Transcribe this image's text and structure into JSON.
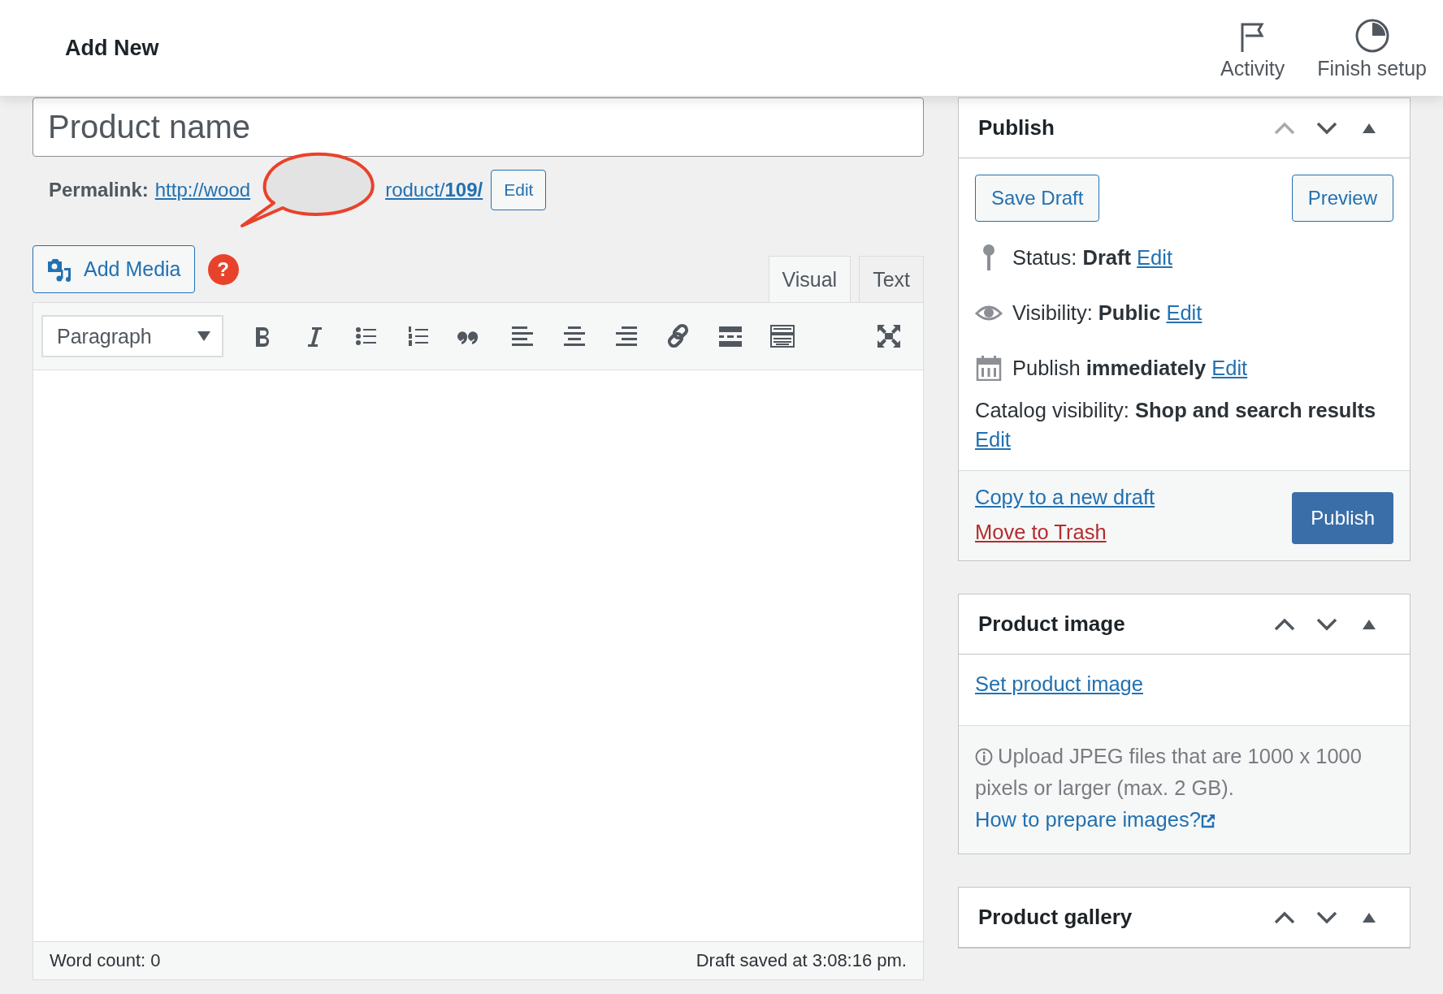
{
  "header": {
    "title": "Add New",
    "actions": [
      {
        "kind": "activity",
        "label": "Activity"
      },
      {
        "kind": "setup",
        "label": "Finish setup"
      }
    ]
  },
  "editor": {
    "title_placeholder": "Product name",
    "permalink": {
      "label": "Permalink:",
      "link_start": "http://wood",
      "link_end": "roduct/**109/**",
      "edit": "Edit"
    },
    "annotation": {
      "kind": "speech-bubble"
    },
    "help_badge": "?",
    "add_media": "Add Media",
    "tabs": [
      {
        "label": "Visual",
        "selected": true
      },
      {
        "label": "Text",
        "selected": false
      }
    ],
    "format_select": "Paragraph",
    "word_count": "Word count: 0",
    "draft_saved": "Draft saved at 3:08:16 pm."
  },
  "sidebar": [
    {
      "kind": "publish",
      "title": "Publish",
      "can_move_up": false,
      "save_draft": "Save Draft",
      "preview": "Preview",
      "meta": [
        {
          "kind": "status",
          "text": "Status: **Draft**",
          "edit": "Edit"
        },
        {
          "kind": "visibility",
          "text": "Visibility: **Public**",
          "edit": "Edit"
        },
        {
          "kind": "schedule",
          "text": "Publish **immediately**",
          "edit": "Edit"
        },
        {
          "kind": "catalog",
          "text": "Catalog visibility: **Shop and search results**",
          "edit": "Edit"
        }
      ],
      "copy_link": "Copy to a new draft",
      "trash_link": "Move to Trash",
      "publish_button": "Publish"
    },
    {
      "kind": "image",
      "title": "Product image",
      "can_move_up": true,
      "link": "Set product image",
      "notice": "Upload JPEG files that are 1000 x 1000 pixels or larger (max. 2 GB).",
      "notice_link": "How to prepare images?"
    },
    {
      "kind": "gallery",
      "title": "Product gallery",
      "can_move_up": true
    }
  ]
}
